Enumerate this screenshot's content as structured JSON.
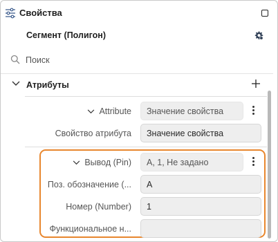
{
  "header": {
    "title": "Свойства",
    "icon": "sliders-icon",
    "window_button": "maximize-icon"
  },
  "subtitle": "Сегмент (Полигон)",
  "settings_icon": "gear-icon",
  "search": {
    "placeholder": "Поиск",
    "value": ""
  },
  "section": {
    "label": "Атрибуты",
    "expanded": true
  },
  "rows": [
    {
      "label": "Attribute",
      "value": "Значение свойства",
      "expandable": true,
      "menu": true
    },
    {
      "label": "Свойство атрибута",
      "value": "Значение свойства",
      "expandable": false,
      "menu": false
    },
    {
      "label": "Вывод (Pin)",
      "value": "A, 1, Не задано",
      "expandable": true,
      "menu": true
    },
    {
      "label": "Поз. обозначение (...",
      "value": "A",
      "expandable": false,
      "menu": false
    },
    {
      "label": "Номер (Number)",
      "value": "1",
      "expandable": false,
      "menu": false
    },
    {
      "label": "Функциональное н...",
      "value": "",
      "expandable": false,
      "menu": false
    }
  ],
  "colors": {
    "highlight": "#e8862d",
    "field_bg": "#eeeeee",
    "scrollbar": "#b9b9b9"
  }
}
